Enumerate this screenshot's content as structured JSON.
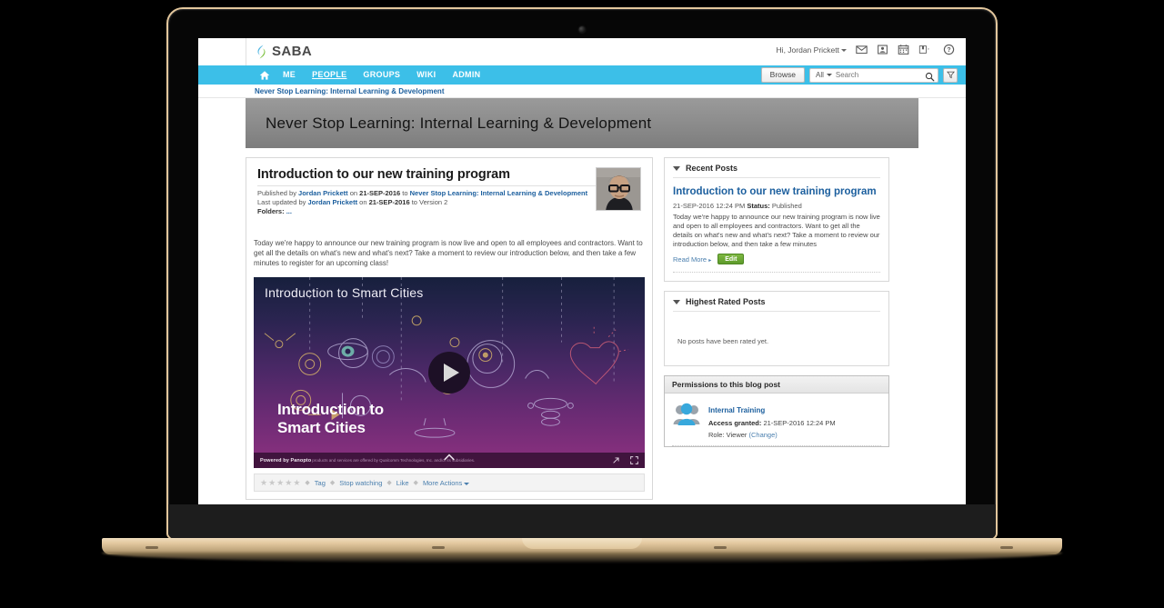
{
  "header": {
    "logo_text": "SABA",
    "logo_icon": "saba-flame-logo",
    "greeting": "Hi, Jordan Prickett",
    "icons": [
      {
        "name": "mail-icon",
        "title": "Messages"
      },
      {
        "name": "profile-card-icon",
        "title": "Profile"
      },
      {
        "name": "calendar-icon",
        "title": "Calendar"
      },
      {
        "name": "bookmark-icon",
        "title": "Bookmarks"
      },
      {
        "name": "help-icon",
        "title": "Help"
      }
    ]
  },
  "nav": {
    "home_icon": "home-icon",
    "items": [
      {
        "label": "ME",
        "active": false
      },
      {
        "label": "PEOPLE",
        "active": true
      },
      {
        "label": "GROUPS",
        "active": false
      },
      {
        "label": "WIKI",
        "active": false
      },
      {
        "label": "ADMIN",
        "active": false
      }
    ],
    "browse_label": "Browse",
    "search_scope": "All",
    "search_placeholder": "Search",
    "search_value": "",
    "search_icon": "magnifier-icon",
    "filter_icon": "funnel-filter-icon"
  },
  "breadcrumb": {
    "text": "Never Stop Learning: Internal Learning & Development"
  },
  "banner": {
    "title": "Never Stop Learning: Internal Learning & Development"
  },
  "post": {
    "title": "Introduction to our new training program",
    "published_prefix": "Published by ",
    "author": "Jordan Prickett",
    "published_on": " on ",
    "published_date": "21-SEP-2016",
    "published_to": " to ",
    "published_group": "Never Stop Learning: Internal Learning & Development",
    "updated_prefix": "Last updated by ",
    "updated_author": "Jordan Prickett",
    "updated_on": " on ",
    "updated_date": "21-SEP-2016",
    "updated_to": " to Version 2",
    "folders_label": "Folders:",
    "folders_value": "...",
    "avatar_name": "user-avatar-photo",
    "body": "Today we're happy to announce our new training program is now live and open to all employees and contractors. Want to get all the details on what's new and what's next? Take a moment to review our introduction below, and then take a few minutes to register for an upcoming class!"
  },
  "video": {
    "overlay_title": "Introduction to Smart Cities",
    "headline_line1": "Introduction to",
    "headline_line2": "Smart Cities",
    "play_icon": "play-button-icon",
    "powered_by": "Powered by Panopto",
    "legal_text": "products and services are offered by Qualcomm Technologies, Inc. and/or its subsidiaries.",
    "expand_icon": "popout-arrow-icon",
    "fullscreen_icon": "fullscreen-icon",
    "chevron_icon": "chevron-up-icon"
  },
  "actionbar": {
    "rating_stars": 5,
    "rating_value": 0,
    "star_glyph": "★",
    "items": [
      {
        "label": "Tag",
        "name": "tag-action"
      },
      {
        "label": "Stop watching",
        "name": "stop-watching-action"
      },
      {
        "label": "Like",
        "name": "like-action"
      },
      {
        "label": "More Actions",
        "name": "more-actions-action"
      }
    ]
  },
  "sidebar": {
    "recent_posts": {
      "title": "Recent Posts",
      "post_title": "Introduction to our new training program",
      "date": "21-SEP-2016 12:24 PM",
      "status_label": "Status:",
      "status_value": "Published",
      "excerpt": "Today we're happy to announce our new training program is now live and open to all employees and contractors. Want to get all the details on what's new and what's next? Take a moment to review our introduction below, and then take a few minutes",
      "read_more": "Read More",
      "read_more_arrow": "▸",
      "edit_label": "Edit"
    },
    "highest_rated": {
      "title": "Highest Rated Posts",
      "empty_text": "No posts have been rated yet."
    },
    "permissions": {
      "title": "Permissions to this blog post",
      "group_icon": "group-users-icon",
      "group_name": "Internal Training",
      "access_label": "Access granted:",
      "access_value": "21-SEP-2016 12:24 PM",
      "role_label": "Role:",
      "role_value": "Viewer",
      "change_label": "(Change)"
    }
  },
  "colors": {
    "nav_blue": "#3cbfe8",
    "link_blue": "#1c5f9e",
    "edit_green": "#5d9a2b",
    "banner_gray": "#8f8f8f",
    "laptop_gold": "#e3c79d"
  }
}
